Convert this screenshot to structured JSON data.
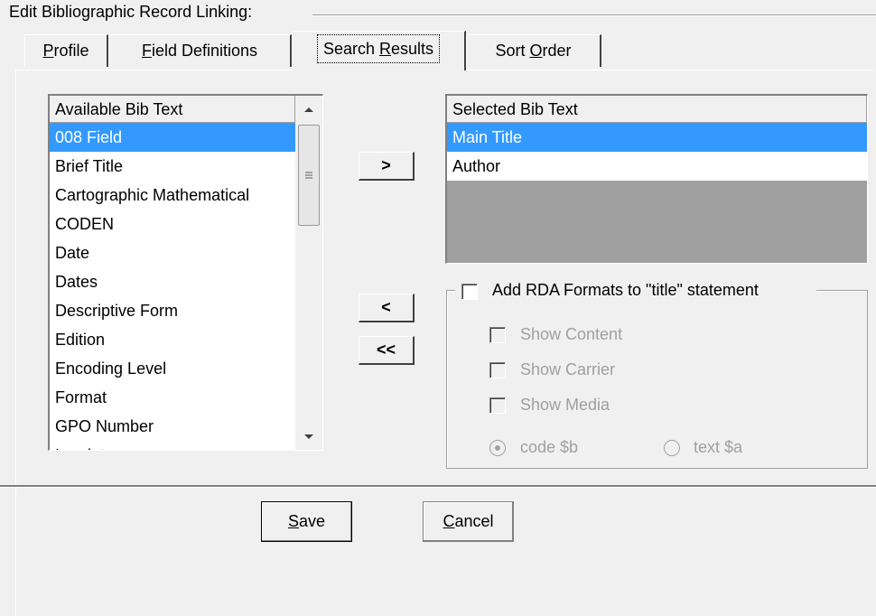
{
  "group_title": "Edit Bibliographic Record Linking:",
  "tabs": [
    {
      "label_u": "P",
      "label_rest": "rofile"
    },
    {
      "label_u": "F",
      "label_rest": "ield Definitions"
    },
    {
      "label_pre": "Search ",
      "label_u": "R",
      "label_rest": "esults"
    },
    {
      "label_pre": "Sort ",
      "label_u": "O",
      "label_rest": "rder"
    }
  ],
  "available": {
    "header": "Available Bib Text",
    "items": [
      "008 Field",
      "Brief Title",
      "Cartographic Mathematical",
      "CODEN",
      "Date",
      "Dates",
      "Descriptive Form",
      "Edition",
      "Encoding Level",
      "Format",
      "GPO Number",
      "Imprint"
    ],
    "selected_index": 0
  },
  "selected": {
    "header": "Selected Bib Text",
    "items": [
      "Main Title",
      "Author"
    ],
    "selected_index": 0
  },
  "move_buttons": {
    "add": ">",
    "remove": "<",
    "remove_all": "<<"
  },
  "rda": {
    "checkbox_label": "Add RDA Formats to \"title\" statement",
    "show_content": "Show Content",
    "show_carrier": "Show Carrier",
    "show_media": "Show Media",
    "radio_code": "code $b",
    "radio_text": "text $a"
  },
  "footer": {
    "save_u": "S",
    "save_rest": "ave",
    "cancel_u": "C",
    "cancel_rest": "ancel"
  }
}
